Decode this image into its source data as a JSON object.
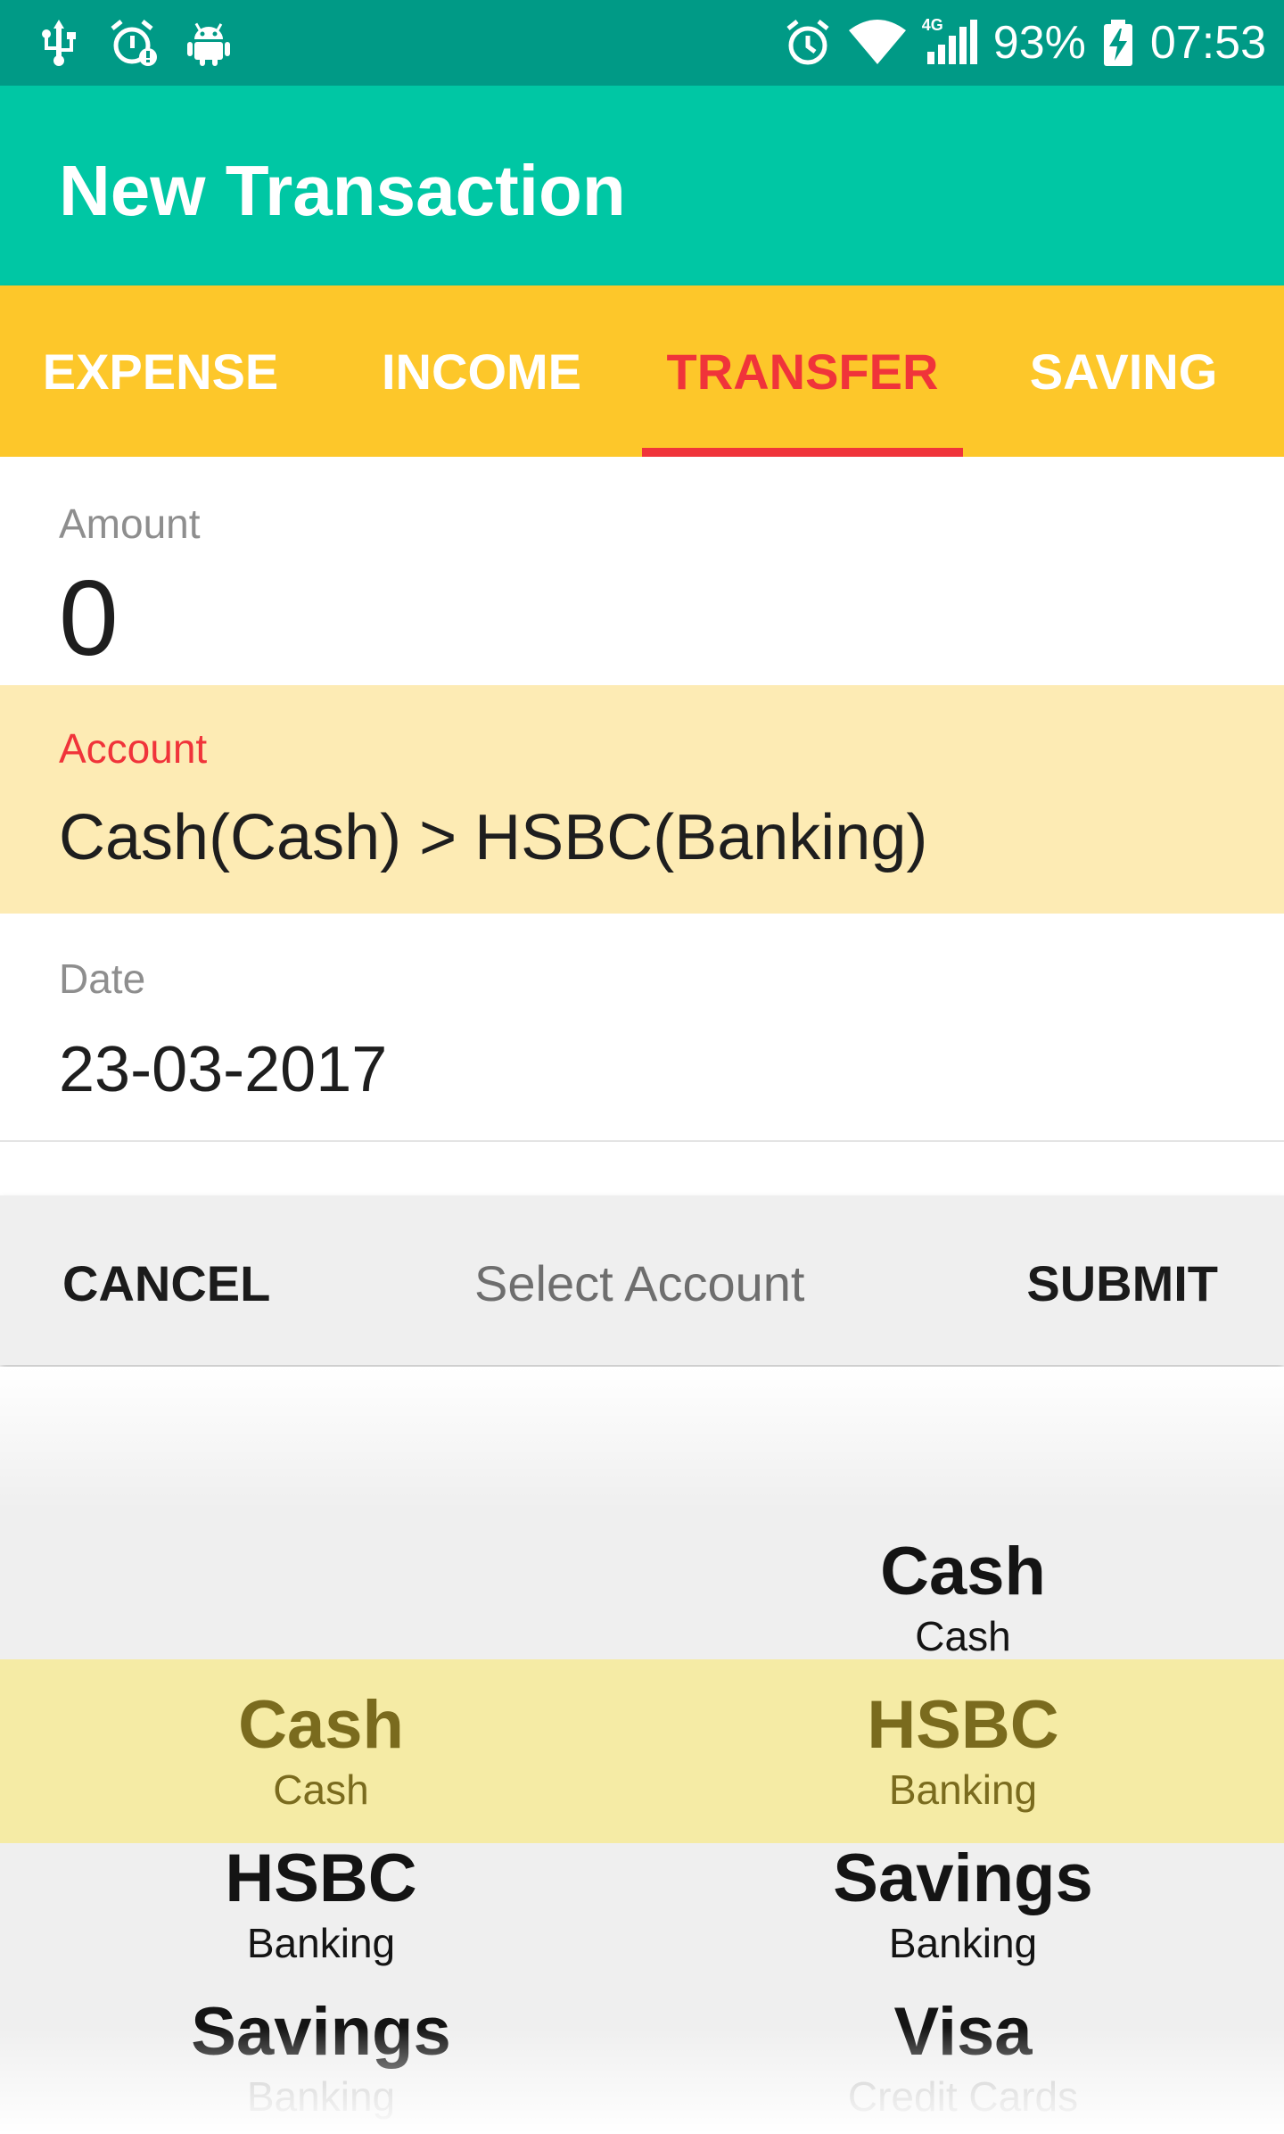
{
  "status_bar": {
    "left_icons": [
      "usb-icon",
      "alarm-alert-icon",
      "android-icon"
    ],
    "right_icons": [
      "alarm-icon",
      "wifi-icon",
      "signal-4g-icon"
    ],
    "network_label": "4G",
    "battery_percent": "93%",
    "time": "07:53"
  },
  "app_bar": {
    "title": "New Transaction"
  },
  "tabs": [
    {
      "label": "EXPENSE",
      "active": false
    },
    {
      "label": "INCOME",
      "active": false
    },
    {
      "label": "TRANSFER",
      "active": true
    },
    {
      "label": "SAVING",
      "active": false
    }
  ],
  "form": {
    "amount": {
      "label": "Amount",
      "value": "0"
    },
    "account": {
      "label": "Account",
      "value": "Cash(Cash) > HSBC(Banking)"
    },
    "date": {
      "label": "Date",
      "value": "23-03-2017"
    }
  },
  "picker": {
    "cancel_label": "CANCEL",
    "title": "Select Account",
    "submit_label": "SUBMIT",
    "from_accounts": [
      {
        "name": "Cash",
        "type": "Cash",
        "selected": true
      },
      {
        "name": "HSBC",
        "type": "Banking",
        "selected": false
      },
      {
        "name": "Savings",
        "type": "Banking",
        "selected": false
      }
    ],
    "to_accounts": [
      {
        "name": "Cash",
        "type": "Cash",
        "selected": false
      },
      {
        "name": "HSBC",
        "type": "Banking",
        "selected": true
      },
      {
        "name": "Savings",
        "type": "Banking",
        "selected": false
      },
      {
        "name": "Visa",
        "type": "Credit Cards",
        "selected": false
      }
    ]
  },
  "colors": {
    "status_bar": "#009a86",
    "app_bar": "#00c7a4",
    "tab_bar": "#fdc72a",
    "accent": "#f0343a",
    "account_highlight": "#fdebb4",
    "picker_highlight": "#f5eba5"
  }
}
